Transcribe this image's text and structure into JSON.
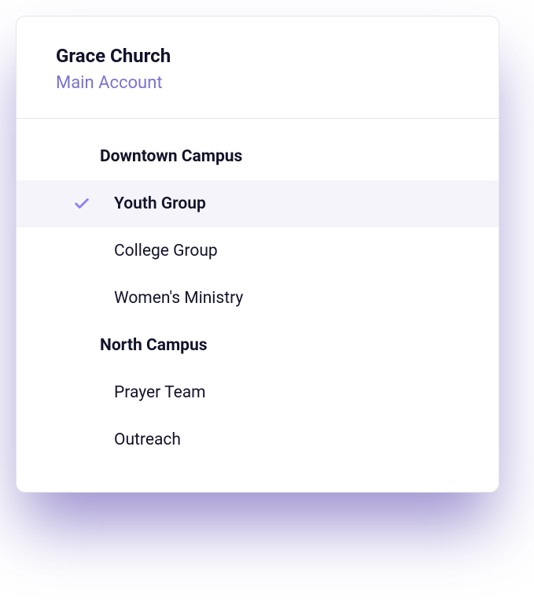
{
  "header": {
    "title": "Grace Church",
    "subtitle": "Main Account"
  },
  "campuses": [
    {
      "name": "Downtown Campus",
      "items": [
        {
          "label": "Youth Group",
          "selected": true
        },
        {
          "label": "College Group",
          "selected": false
        },
        {
          "label": "Women's Ministry",
          "selected": false
        }
      ]
    },
    {
      "name": "North Campus",
      "items": [
        {
          "label": "Prayer Team",
          "selected": false
        },
        {
          "label": "Outreach",
          "selected": false
        }
      ]
    }
  ]
}
